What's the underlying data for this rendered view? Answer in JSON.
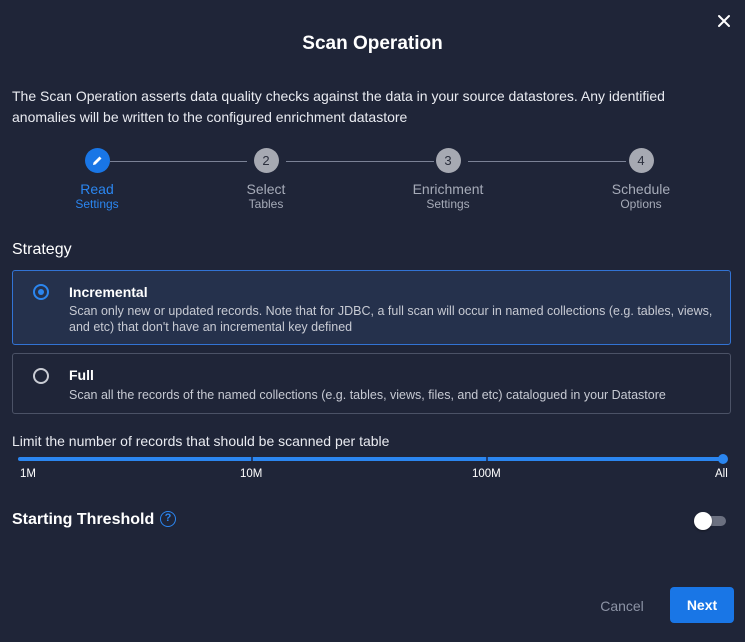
{
  "dialog": {
    "title": "Scan Operation",
    "description": "The Scan Operation asserts data quality checks against the data in your source datastores. Any identified anomalies will be written to the configured enrichment datastore",
    "close_icon": "close-icon"
  },
  "stepper": {
    "steps": [
      {
        "number": "",
        "label": "Read",
        "sub": "Settings",
        "active": true,
        "icon": "pencil-icon"
      },
      {
        "number": "2",
        "label": "Select",
        "sub": "Tables",
        "active": false
      },
      {
        "number": "3",
        "label": "Enrichment",
        "sub": "Settings",
        "active": false
      },
      {
        "number": "4",
        "label": "Schedule",
        "sub": "Options",
        "active": false
      }
    ]
  },
  "strategy": {
    "title": "Strategy",
    "options": [
      {
        "title": "Incremental",
        "description": "Scan only new or updated records. Note that for JDBC, a full scan will occur in named collections (e.g. tables, views, and etc) that don't have an incremental key defined",
        "selected": true
      },
      {
        "title": "Full",
        "description": "Scan all the records of the named collections (e.g. tables, views, files, and etc) catalogued in your Datastore",
        "selected": false
      }
    ]
  },
  "limit": {
    "label": "Limit the number of records that should be scanned per table",
    "ticks": [
      "1M",
      "10M",
      "100M",
      "All"
    ],
    "value": "All"
  },
  "threshold": {
    "label": "Starting Threshold",
    "help_icon": "help-circle-icon",
    "enabled": false
  },
  "footer": {
    "cancel_label": "Cancel",
    "next_label": "Next"
  },
  "colors": {
    "background": "#1f2538",
    "accent": "#1976e6",
    "selected_bg": "#25314c"
  }
}
